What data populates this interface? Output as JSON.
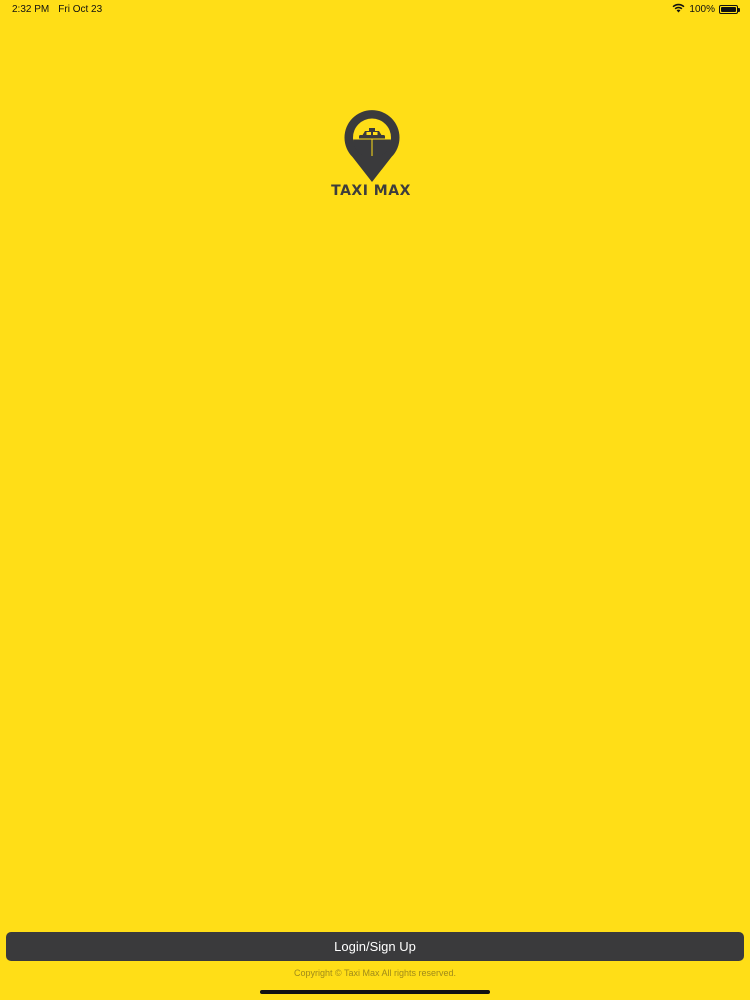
{
  "status_bar": {
    "time": "2:32 PM",
    "date": "Fri Oct 23",
    "battery_text": "100%",
    "battery_level": 1.0
  },
  "logo": {
    "brand_text": "TAXI MAX",
    "icon": "map-pin-taxi-icon",
    "pin_color": "#3a3a3c"
  },
  "actions": {
    "login_label": "Login/Sign Up"
  },
  "footer": {
    "copyright": "Copyright © Taxi Max All rights reserved."
  },
  "colors": {
    "background": "#FFDE17",
    "button": "#3a3a3c",
    "button_text": "#ffffff"
  }
}
